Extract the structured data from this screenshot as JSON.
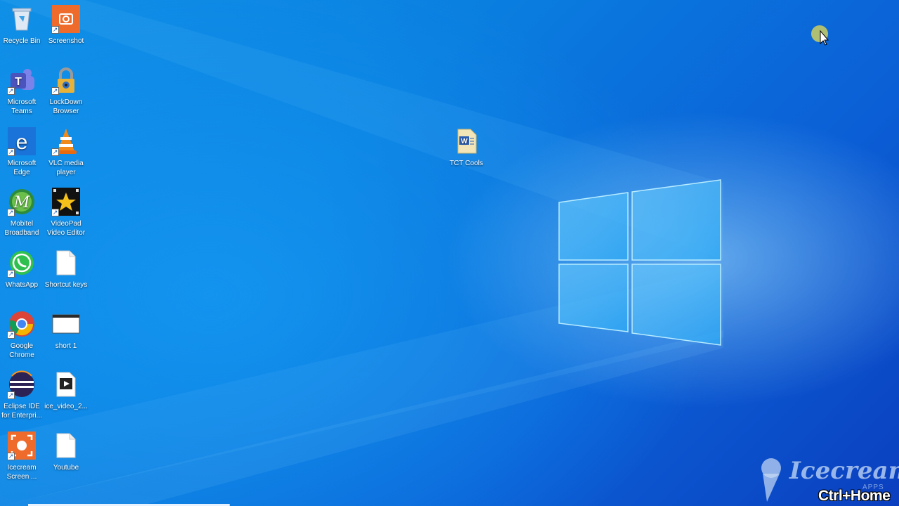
{
  "desktop": {
    "icons": [
      {
        "label": "Recycle Bin",
        "icon": "recycle-bin-icon"
      },
      {
        "label": "Screenshot",
        "icon": "screenshot-icon"
      },
      {
        "label": "Microsoft Teams",
        "icon": "teams-icon"
      },
      {
        "label": "LockDown Browser",
        "icon": "lockdown-browser-icon"
      },
      {
        "label": "Microsoft Edge",
        "icon": "edge-icon"
      },
      {
        "label": "VLC media player",
        "icon": "vlc-icon"
      },
      {
        "label": "Mobitel Broadband",
        "icon": "mobitel-icon"
      },
      {
        "label": "VideoPad Video Editor",
        "icon": "videopad-icon"
      },
      {
        "label": "WhatsApp",
        "icon": "whatsapp-icon"
      },
      {
        "label": "Shortcut keys",
        "icon": "text-file-icon"
      },
      {
        "label": "Google Chrome",
        "icon": "chrome-icon"
      },
      {
        "label": "short 1",
        "icon": "image-file-icon"
      },
      {
        "label": "Eclipse IDE for Enterpri...",
        "icon": "eclipse-icon"
      },
      {
        "label": "ice_video_2...",
        "icon": "video-file-icon"
      },
      {
        "label": "Icecream Screen ...",
        "icon": "icecream-recorder-icon"
      },
      {
        "label": "Youtube",
        "icon": "text-file-icon"
      },
      {
        "label": "TCT Cools",
        "icon": "word-document-icon"
      }
    ]
  },
  "overlay": {
    "watermark_brand": "Icecream",
    "watermark_sub": "APPS",
    "hotkey": "Ctrl+Home"
  },
  "colors": {
    "wallpaper_primary": "#0a7fe0",
    "wallpaper_dark": "#0b3fbf",
    "logo_glow": "#9fe0ff"
  }
}
